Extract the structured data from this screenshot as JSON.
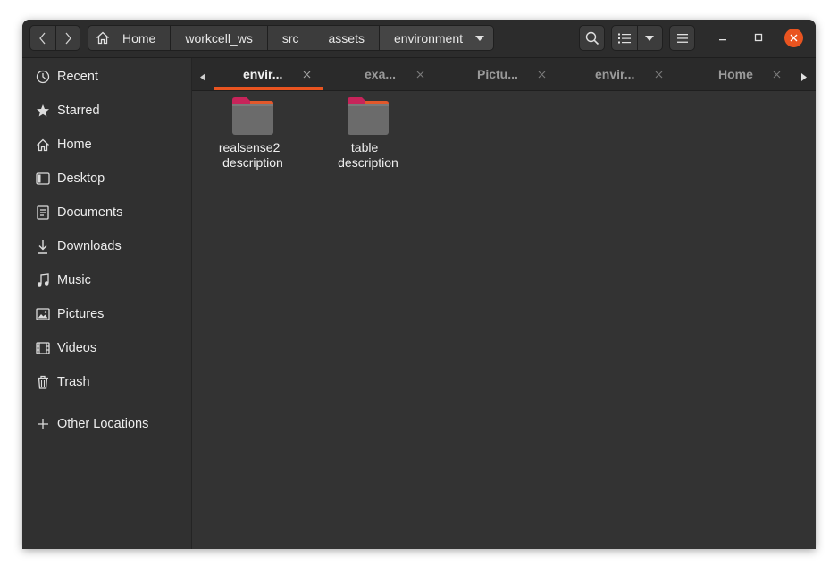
{
  "header": {
    "nav": {
      "back_icon": "chevron-left-icon",
      "forward_icon": "chevron-right-icon"
    },
    "breadcrumb": [
      {
        "label": "Home",
        "icon": "home-icon"
      },
      {
        "label": "workcell_ws"
      },
      {
        "label": "src"
      },
      {
        "label": "assets"
      },
      {
        "label": "environment",
        "icon": "dropdown-arrow-icon"
      }
    ],
    "toolbar": {
      "search_icon": "search-icon",
      "view_icon": "list-view-icon",
      "view_menu_icon": "dropdown-arrow-icon",
      "menu_icon": "hamburger-menu-icon"
    },
    "window_controls": {
      "minimize": "minimize-icon",
      "maximize": "maximize-icon",
      "close": "close-icon"
    }
  },
  "sidebar": {
    "items": [
      {
        "label": "Recent",
        "icon": "recent-icon"
      },
      {
        "label": "Starred",
        "icon": "star-icon"
      },
      {
        "label": "Home",
        "icon": "home-icon"
      },
      {
        "label": "Desktop",
        "icon": "desktop-icon"
      },
      {
        "label": "Documents",
        "icon": "documents-icon"
      },
      {
        "label": "Downloads",
        "icon": "downloads-icon"
      },
      {
        "label": "Music",
        "icon": "music-icon"
      },
      {
        "label": "Pictures",
        "icon": "pictures-icon"
      },
      {
        "label": "Videos",
        "icon": "videos-icon"
      },
      {
        "label": "Trash",
        "icon": "trash-icon"
      }
    ],
    "other": {
      "label": "Other Locations",
      "icon": "plus-icon"
    }
  },
  "tabs": {
    "items": [
      {
        "label": "envir...",
        "active": true
      },
      {
        "label": "exa..."
      },
      {
        "label": "Pictu..."
      },
      {
        "label": "envir..."
      },
      {
        "label": "Home"
      }
    ]
  },
  "content": {
    "folders": [
      {
        "line1": "realsense2_",
        "line2": "description",
        "icon": "folder-icon"
      },
      {
        "line1": "table_",
        "line2": "description",
        "icon": "folder-icon"
      }
    ]
  },
  "colors": {
    "accent": "#e95420",
    "folder_tab": "#c7245a",
    "folder_body": "#6b6b6b"
  }
}
